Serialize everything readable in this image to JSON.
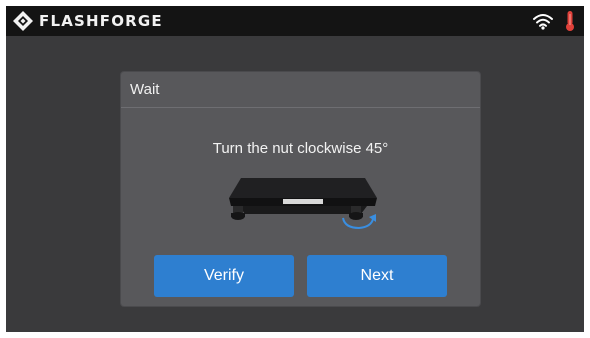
{
  "topbar": {
    "brand_name": "FLASHFORGE",
    "icons": {
      "logo": "flashforge-logo-icon",
      "wifi": "wifi-icon",
      "temperature": "thermometer-icon"
    }
  },
  "dialog": {
    "title": "Wait",
    "message": "Turn the nut clockwise 45°",
    "illustration": "build-plate-leveling-nut-icon",
    "buttons": {
      "verify_label": "Verify",
      "next_label": "Next"
    }
  },
  "colors": {
    "background": "#3a3a3c",
    "topbar": "#141414",
    "dialog": "#58585b",
    "button": "#2e7fd0",
    "arrow_accent": "#3a8ee0",
    "thermometer": "#e0413a"
  }
}
